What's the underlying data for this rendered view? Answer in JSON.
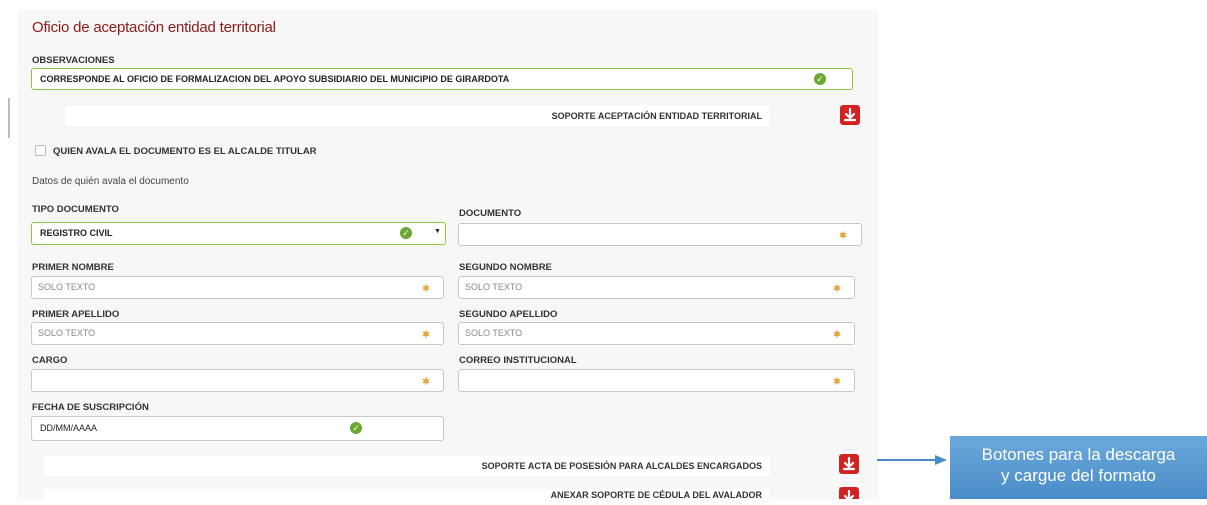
{
  "form": {
    "title": "Oficio de aceptación entidad territorial",
    "observaciones": {
      "label": "OBSERVACIONES",
      "value": "CORRESPONDE AL OFICIO DE FORMALIZACION DEL APOYO SUBSIDIARIO DEL MUNICIPIO DE GIRARDOTA"
    },
    "soporte_aceptacion": "SOPORTE ACEPTACIÓN ENTIDAD TERRITORIAL",
    "alcalde_checkbox_label": "QUIEN AVALA EL DOCUMENTO ES EL ALCALDE TITULAR",
    "section_avala": "Datos de quién avala el documento",
    "tipo_documento": {
      "label": "TIPO DOCUMENTO",
      "value": "REGISTRO CIVIL"
    },
    "documento": {
      "label": "DOCUMENTO",
      "value": ""
    },
    "primer_nombre": {
      "label": "PRIMER NOMBRE",
      "placeholder": "SOLO TEXTO"
    },
    "segundo_nombre": {
      "label": "SEGUNDO NOMBRE",
      "placeholder": "SOLO TEXTO"
    },
    "primer_apellido": {
      "label": "PRIMER APELLIDO",
      "placeholder": "SOLO TEXTO"
    },
    "segundo_apellido": {
      "label": "SEGUNDO APELLIDO",
      "placeholder": "SOLO TEXTO"
    },
    "cargo": {
      "label": "CARGO",
      "value": ""
    },
    "correo": {
      "label": "CORREO INSTITUCIONAL",
      "value": ""
    },
    "fecha": {
      "label": "FECHA DE SUSCRIPCIÓN",
      "value": "DD/MM/AAAA"
    },
    "soporte_posesion": "SOPORTE ACTA DE POSESIÓN PARA ALCALDES ENCARGADOS",
    "soporte_cedula": "ANEXAR SOPORTE DE CÉDULA DEL AVALADOR"
  },
  "callout": {
    "line1": "Botones para la descarga",
    "line2": "y cargue del formato"
  },
  "colors": {
    "title": "#8b1a1a",
    "valid_border": "#8dc63f",
    "download_button": "#d32222",
    "required_icon": "#e8a33a",
    "callout": "#4a8cc8"
  },
  "icons": {
    "valid": "check-circle-icon",
    "required": "asterisk-icon",
    "download": "download-icon",
    "dropdown": "caret-down-icon"
  }
}
